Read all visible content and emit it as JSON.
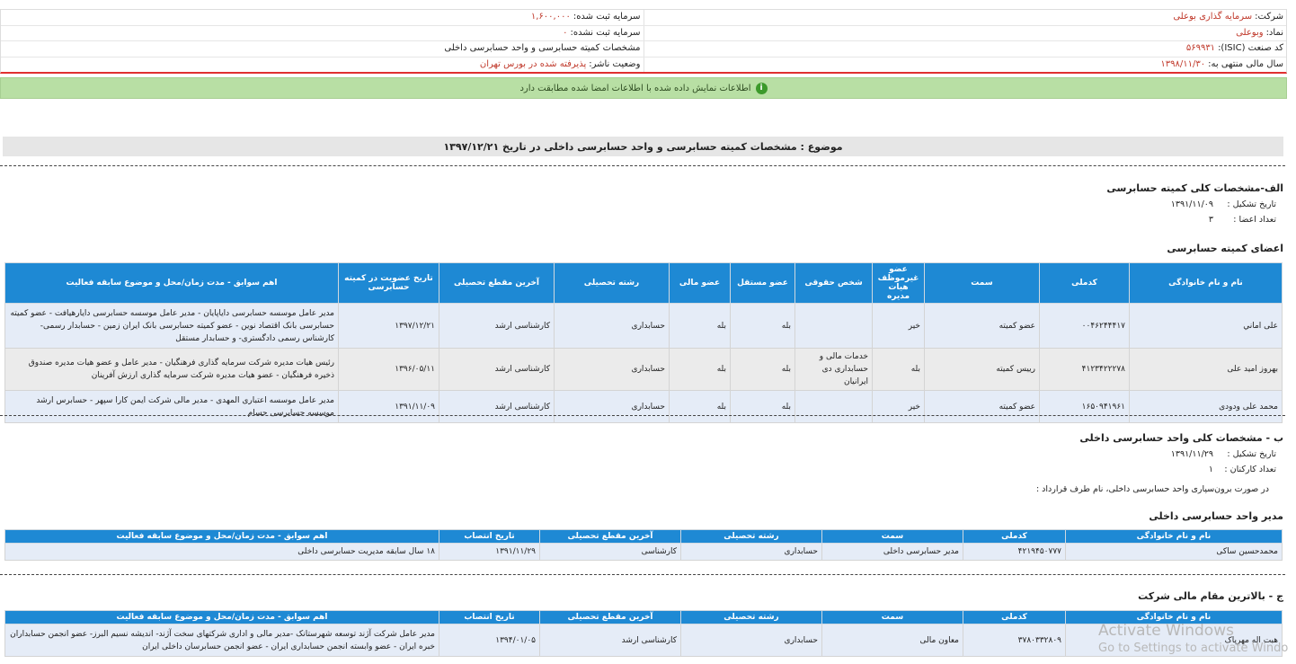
{
  "company_info": {
    "company_label": "شرکت:",
    "company_value": "سرمایه گذاری بوعلی",
    "symbol_label": "نماد:",
    "symbol_value": "وبوعلی",
    "isic_label": "کد صنعت (ISIC):",
    "isic_value": "۵۶۹۹۳۱",
    "fiscal_label": "سال مالی منتهی به:",
    "fiscal_value": "۱۳۹۸/۱۱/۳۰",
    "capital_reg_label": "سرمایه ثبت شده:",
    "capital_reg_value": "۱,۶۰۰,۰۰۰",
    "capital_unreg_label": "سرمایه ثبت نشده:",
    "capital_unreg_value": "۰",
    "spec_label": "مشخصات کمیته حسابرسی و واحد حسابرسی داخلی",
    "status_label": "وضعیت ناشر:",
    "status_value": "پذیرفته شده در بورس تهران"
  },
  "notice": {
    "text": "اطلاعات نمایش داده شده با اطلاعات امضا شده مطابقت دارد",
    "icon": "info-icon"
  },
  "subject": "موضوع : مشخصات کمیته حسابرسی و واحد حسابرسی داخلی در تاریخ ۱۳۹۷/۱۲/۲۱",
  "section_a": {
    "title": "الف-مشخصات کلی کمیته حسابرسی",
    "formation_label": "تاریخ تشکیل :",
    "formation_value": "۱۳۹۱/۱۱/۰۹",
    "members_count_label": "تعداد اعضا :",
    "members_count_value": "۳",
    "members_title": "اعضای کمیته حسابرسی",
    "headers": [
      "نام و نام خانوادگی",
      "کدملی",
      "سمت",
      "عضو غیرموظف هیات مدیره",
      "شخص حقوقی",
      "عضو مستقل",
      "عضو مالی",
      "رشته تحصیلی",
      "آخرین مقطع تحصیلی",
      "تاریخ عضویت در کمیته حسابرسی",
      "اهم سوابق - مدت زمان/محل و موضوع سابقه فعالیت"
    ],
    "rows": [
      [
        "علی اماني",
        "۰۰۴۶۲۴۴۴۱۷",
        "عضو کمیته",
        "خیر",
        "",
        "بله",
        "بله",
        "حسابداری",
        "کارشناسی ارشد",
        "۱۳۹۷/۱۲/۲۱",
        "مدیر عامل موسسه حسابرسی دایاپایان - مدیر عامل موسسه حسابرسی دایارهیافت - عضو کمیته حسابرسی بانک اقتصاد نوین - عضو کمیته حسابرسی بانک ایران زمین - حسابدار رسمی- کارشناس رسمی دادگستری- و حسابدار مستقل"
      ],
      [
        "بهروز امید علی",
        "۴۱۲۳۴۲۲۲۷۸",
        "رییس کمیته",
        "بله",
        "خدمات مالی و حسابداری دی ایرانیان",
        "بله",
        "بله",
        "حسابداری",
        "کارشناسی ارشد",
        "۱۳۹۶/۰۵/۱۱",
        "رئیس هیات مدیره شرکت سرمایه گذاری فرهنگیان - مدیر عامل و عضو هیات مدیره صندوق ذخیره فرهنگیان - عضو هیات مدیره شرکت سرمایه گذاری ارزش آفرینان"
      ],
      [
        "محمد علی ودودی",
        "۱۶۵۰۹۴۱۹۶۱",
        "عضو کمیته",
        "خیر",
        "",
        "بله",
        "بله",
        "حسابداری",
        "کارشناسی ارشد",
        "۱۳۹۱/۱۱/۰۹",
        "مدیر عامل موسسه اعتباری المهدی - مدیر مالی شرکت ایمن کارا سپهر - حسابرس ارشد موسسه حسابرسی حسام"
      ]
    ]
  },
  "section_b": {
    "title": "ب - مشخصات کلی واحد حسابرسی داخلی",
    "formation_label": "تاریخ تشکیل :",
    "formation_value": "۱۳۹۱/۱۱/۲۹",
    "staff_label": "تعداد کارکنان :",
    "staff_value": "۱",
    "outsource_label": "در صورت برون‌سپاری واحد حسابرسی داخلی، نام طرف قرارداد :",
    "manager_title": "مدیر واحد حسابرسی داخلی",
    "headers": [
      "نام و نام خانوادگی",
      "کدملی",
      "سمت",
      "رشته تحصیلی",
      "آخرین مقطع تحصیلی",
      "تاریخ انتصاب",
      "اهم سوابق - مدت زمان/محل و موضوع سابقه فعالیت"
    ],
    "rows": [
      [
        "محمدحسین ساکی",
        "۴۲۱۹۴۵۰۷۷۷",
        "مدیر حسابرسی داخلی",
        "حسابداری",
        "کارشناسی",
        "۱۳۹۱/۱۱/۲۹",
        "۱۸ سال سابقه مدیریت حسابرسی داخلی"
      ]
    ]
  },
  "section_c": {
    "title": "ج - بالاترین مقام مالی شرکت",
    "headers": [
      "نام و نام خانوادگی",
      "کدملی",
      "سمت",
      "رشته تحصیلی",
      "آخرین مقطع تحصیلی",
      "تاریخ انتصاب",
      "اهم سوابق - مدت زمان/محل و موضوع سابقه فعالیت"
    ],
    "rows": [
      [
        "هبت اله مهرپاک",
        "۳۷۸۰۳۳۲۸۰۹",
        "معاون مالی",
        "حسابداری",
        "کارشناسی ارشد",
        "۱۳۹۴/۰۱/۰۵",
        "مدیر عامل شرکت آژند توسعه شهرستانک -مدیر مالی و اداری شرکتهای سخت آژند- اندیشه نسیم البرز- عضو انجمن حسابداران خبره ایران - عضو وابسته انجمن حسابداری ایران - عضو انجمن حسابرسان داخلی ایران"
      ]
    ]
  },
  "watermark": {
    "line1": "Activate Windows",
    "line2": "Go to Settings to activate Windo"
  },
  "colors": {
    "header_blue": "#1e89d4",
    "notice_green": "#b8dfa4",
    "accent_red": "#c0392b"
  }
}
